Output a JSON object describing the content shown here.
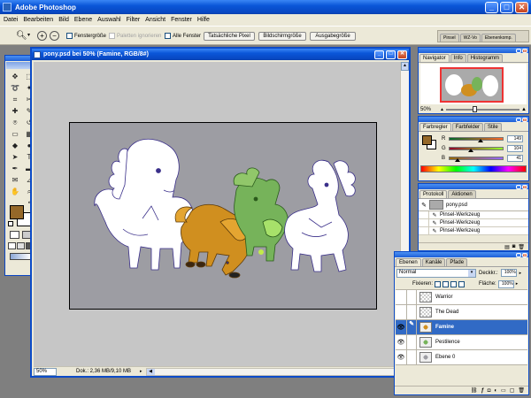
{
  "app": {
    "title": "Adobe Photoshop"
  },
  "menu": [
    "Datei",
    "Bearbeiten",
    "Bild",
    "Ebene",
    "Auswahl",
    "Filter",
    "Ansicht",
    "Fenster",
    "Hilfe"
  ],
  "options_bar": {
    "fit_window": "Fenstergröße",
    "ignore_palettes": "Paletten ignorieren",
    "all_windows": "Alle Fenster",
    "actual_pixels": "Tatsächliche Pixel",
    "fit_screen": "Bildschirmgröße",
    "print_size": "Ausgabegröße",
    "well_tabs": [
      "Pinsel",
      "WZ-Vo",
      "Ebenenkomp."
    ]
  },
  "document": {
    "title": "pony.psd bei 50% (Famine, RGB/8#)",
    "zoom": "50%",
    "doc_info": "Dok.: 2,36 MB/9,10 MB"
  },
  "navigator": {
    "tabs": [
      "Navigator",
      "Info",
      "Histogramm"
    ],
    "zoom": "50%"
  },
  "color_panel": {
    "tabs": [
      "Farbregler",
      "Farbfelder",
      "Stile"
    ],
    "channels": [
      {
        "label": "R",
        "value": "149",
        "pos": 0.58
      },
      {
        "label": "G",
        "value": "104",
        "pos": 0.41
      },
      {
        "label": "B",
        "value": "41",
        "pos": 0.16
      }
    ],
    "fg_color": "#956829"
  },
  "history": {
    "tabs": [
      "Protokoll",
      "Aktionen"
    ],
    "snapshot": "pony.psd",
    "items": [
      "Pinsel-Werkzeug",
      "Pinsel-Werkzeug",
      "Pinsel-Werkzeug"
    ]
  },
  "layers": {
    "tabs": [
      "Ebenen",
      "Kanäle",
      "Pfade"
    ],
    "blend_mode": "Normal",
    "opacity_label": "Deckkr.:",
    "opacity": "100%",
    "lock_label": "Fixieren:",
    "fill_label": "Fläche:",
    "fill": "100%",
    "items": [
      {
        "name": "Warrior",
        "visible": false,
        "selected": false
      },
      {
        "name": "The Dead",
        "visible": false,
        "selected": false
      },
      {
        "name": "Famine",
        "visible": true,
        "selected": true
      },
      {
        "name": "Pestilence",
        "visible": true,
        "selected": false
      },
      {
        "name": "Ebene 0",
        "visible": true,
        "selected": false
      }
    ]
  },
  "toolbox": {
    "tools": [
      "move",
      "marquee",
      "lasso",
      "magic-wand",
      "crop",
      "slice",
      "healing",
      "brush",
      "stamp",
      "history-brush",
      "eraser",
      "gradient",
      "blur",
      "dodge",
      "path-select",
      "type",
      "pen",
      "shape",
      "notes",
      "eyedropper",
      "hand",
      "zoom"
    ]
  }
}
